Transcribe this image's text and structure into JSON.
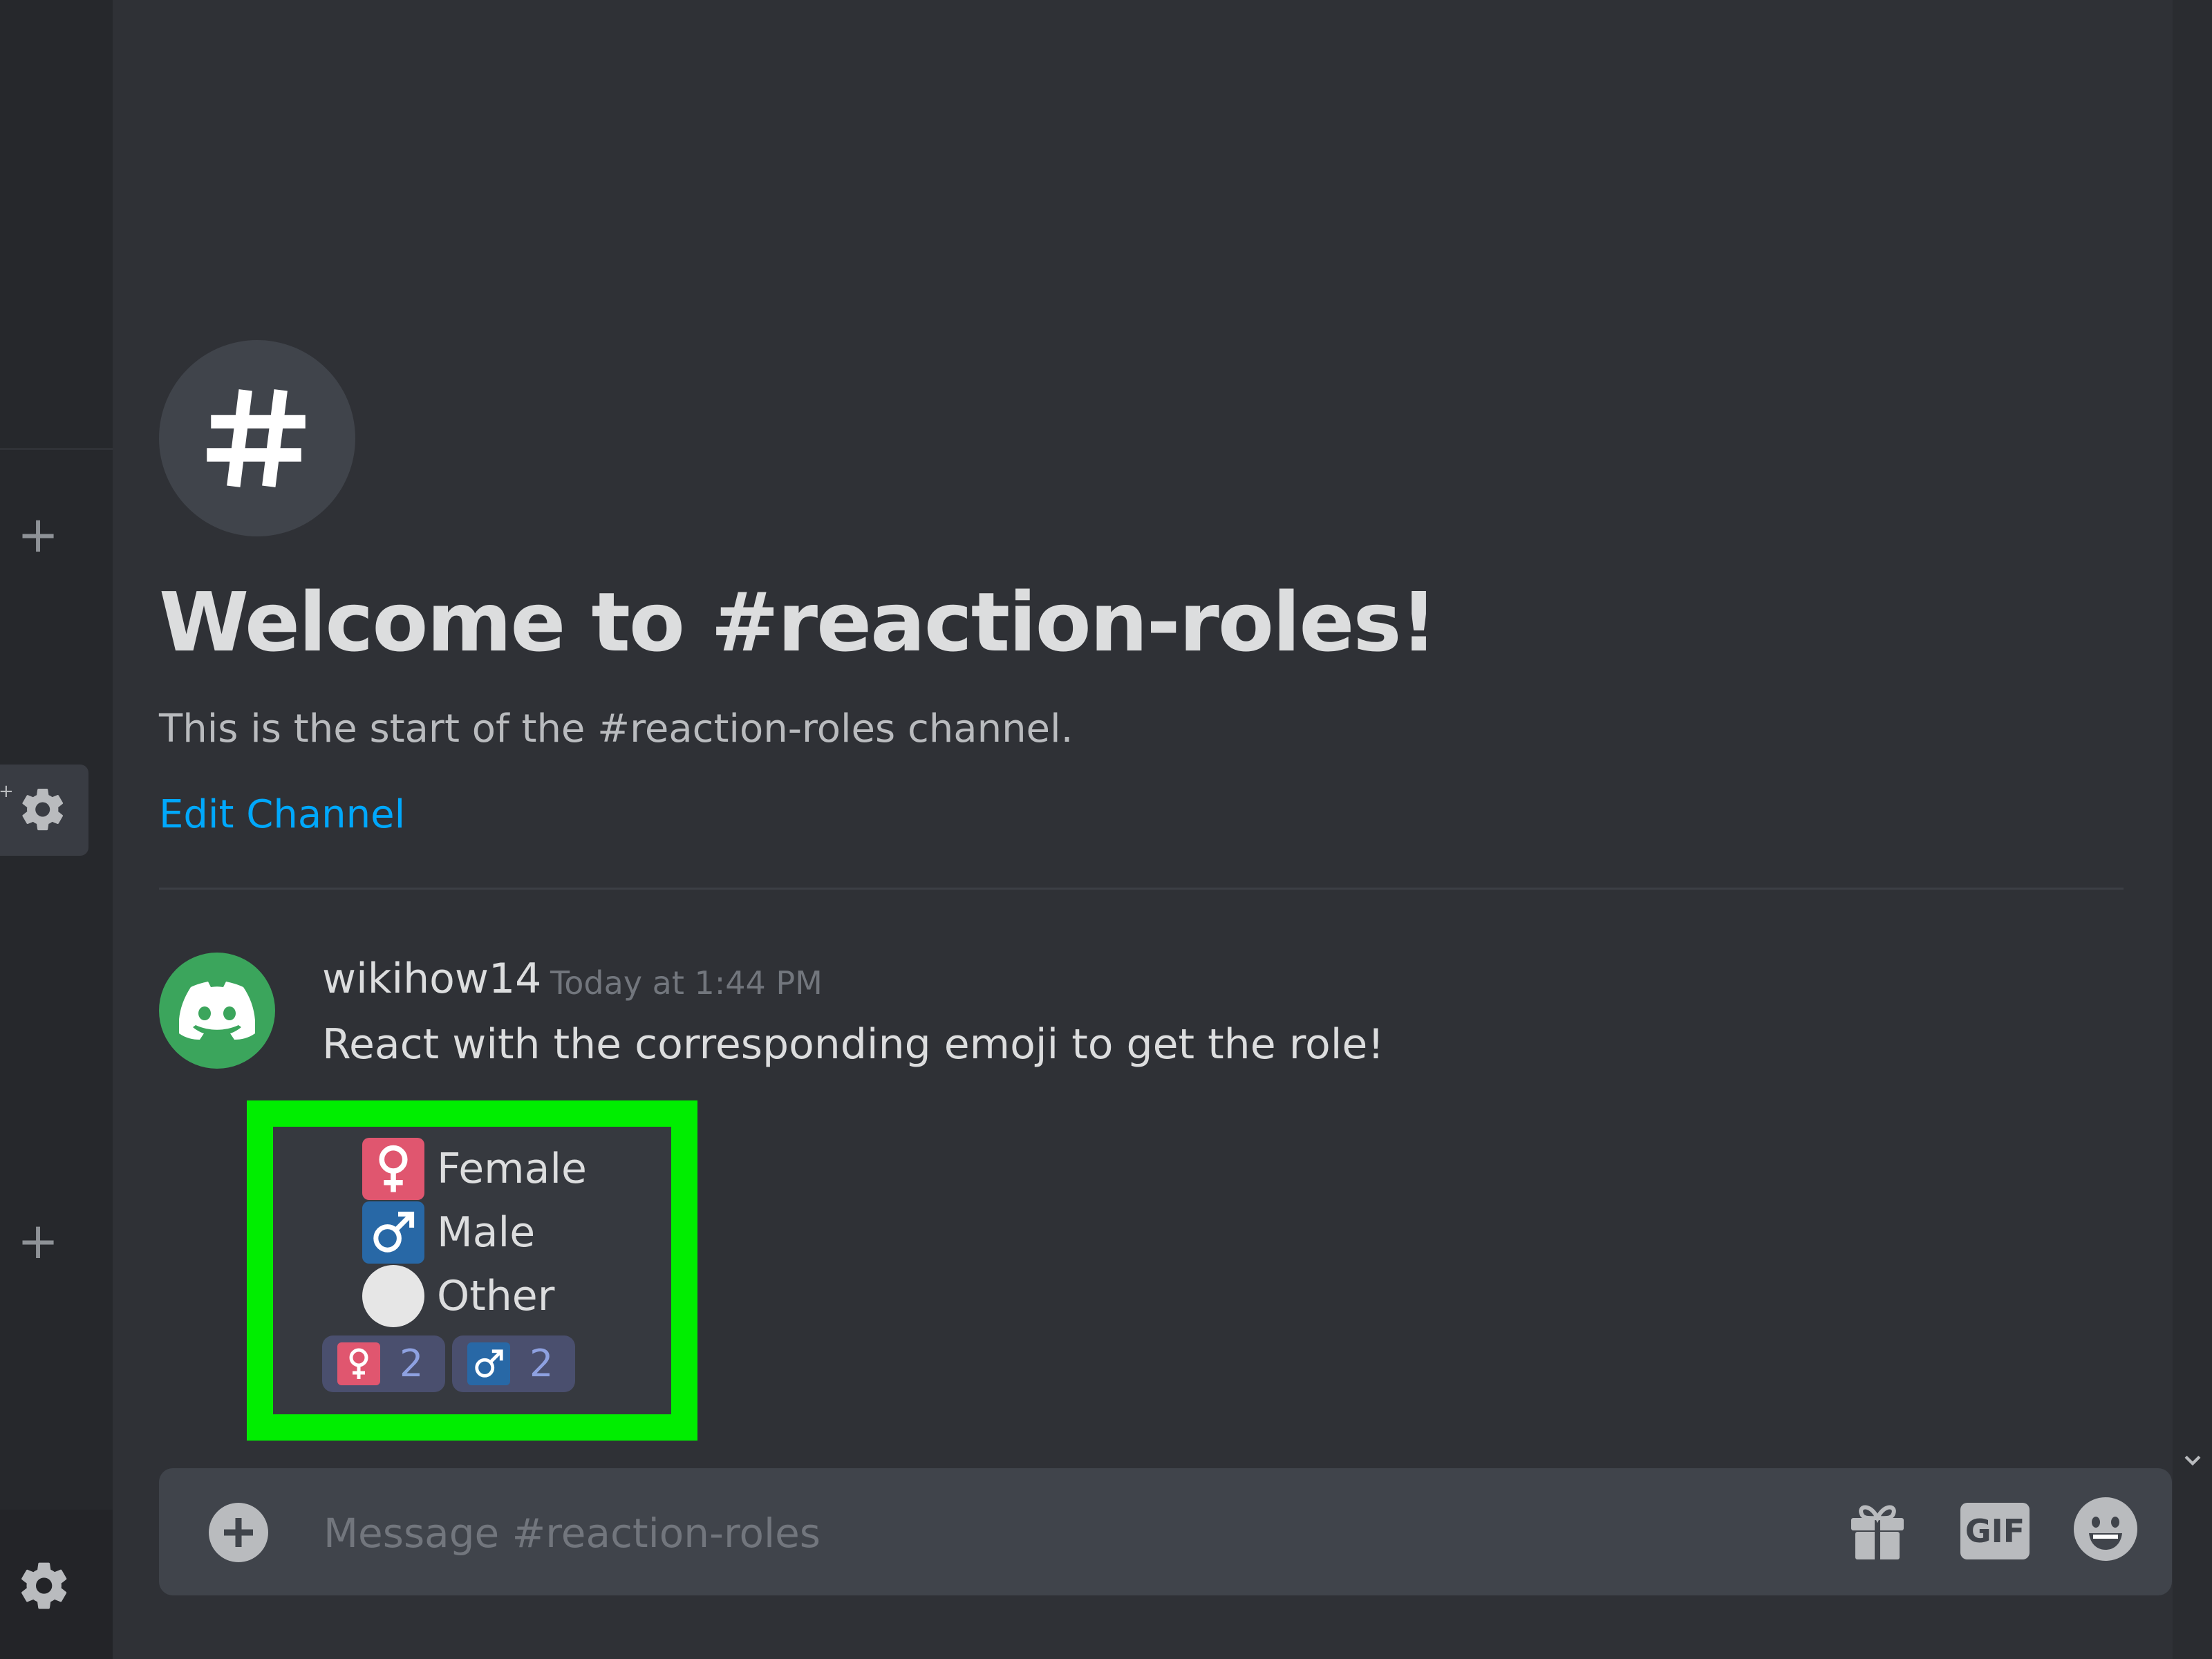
{
  "channel": {
    "welcome_title": "Welcome to #reaction-roles!",
    "welcome_subtitle": "This is the start of the #reaction-roles channel.",
    "edit_link": "Edit Channel",
    "icon": "hash-icon"
  },
  "message": {
    "author": "wikihow14",
    "timestamp": "Today at 1:44 PM",
    "text": "React with the corresponding emoji to get the role!",
    "roles": [
      {
        "label": "Female",
        "icon": "female-sign-icon"
      },
      {
        "label": "Male",
        "icon": "male-sign-icon"
      },
      {
        "label": "Other",
        "icon": "white-circle-icon"
      }
    ],
    "reactions": [
      {
        "icon": "female-sign-icon",
        "count": "2"
      },
      {
        "icon": "male-sign-icon",
        "count": "2"
      }
    ]
  },
  "composer": {
    "placeholder": "Message #reaction-roles",
    "gif_label": "GIF"
  },
  "colors": {
    "background": "#2f3136",
    "highlight": "#00ee00",
    "link": "#00a8fc",
    "female": "#e0566f",
    "male": "#2868a6",
    "reaction_bg": "#4a4f6e",
    "avatar": "#3ba55c"
  }
}
